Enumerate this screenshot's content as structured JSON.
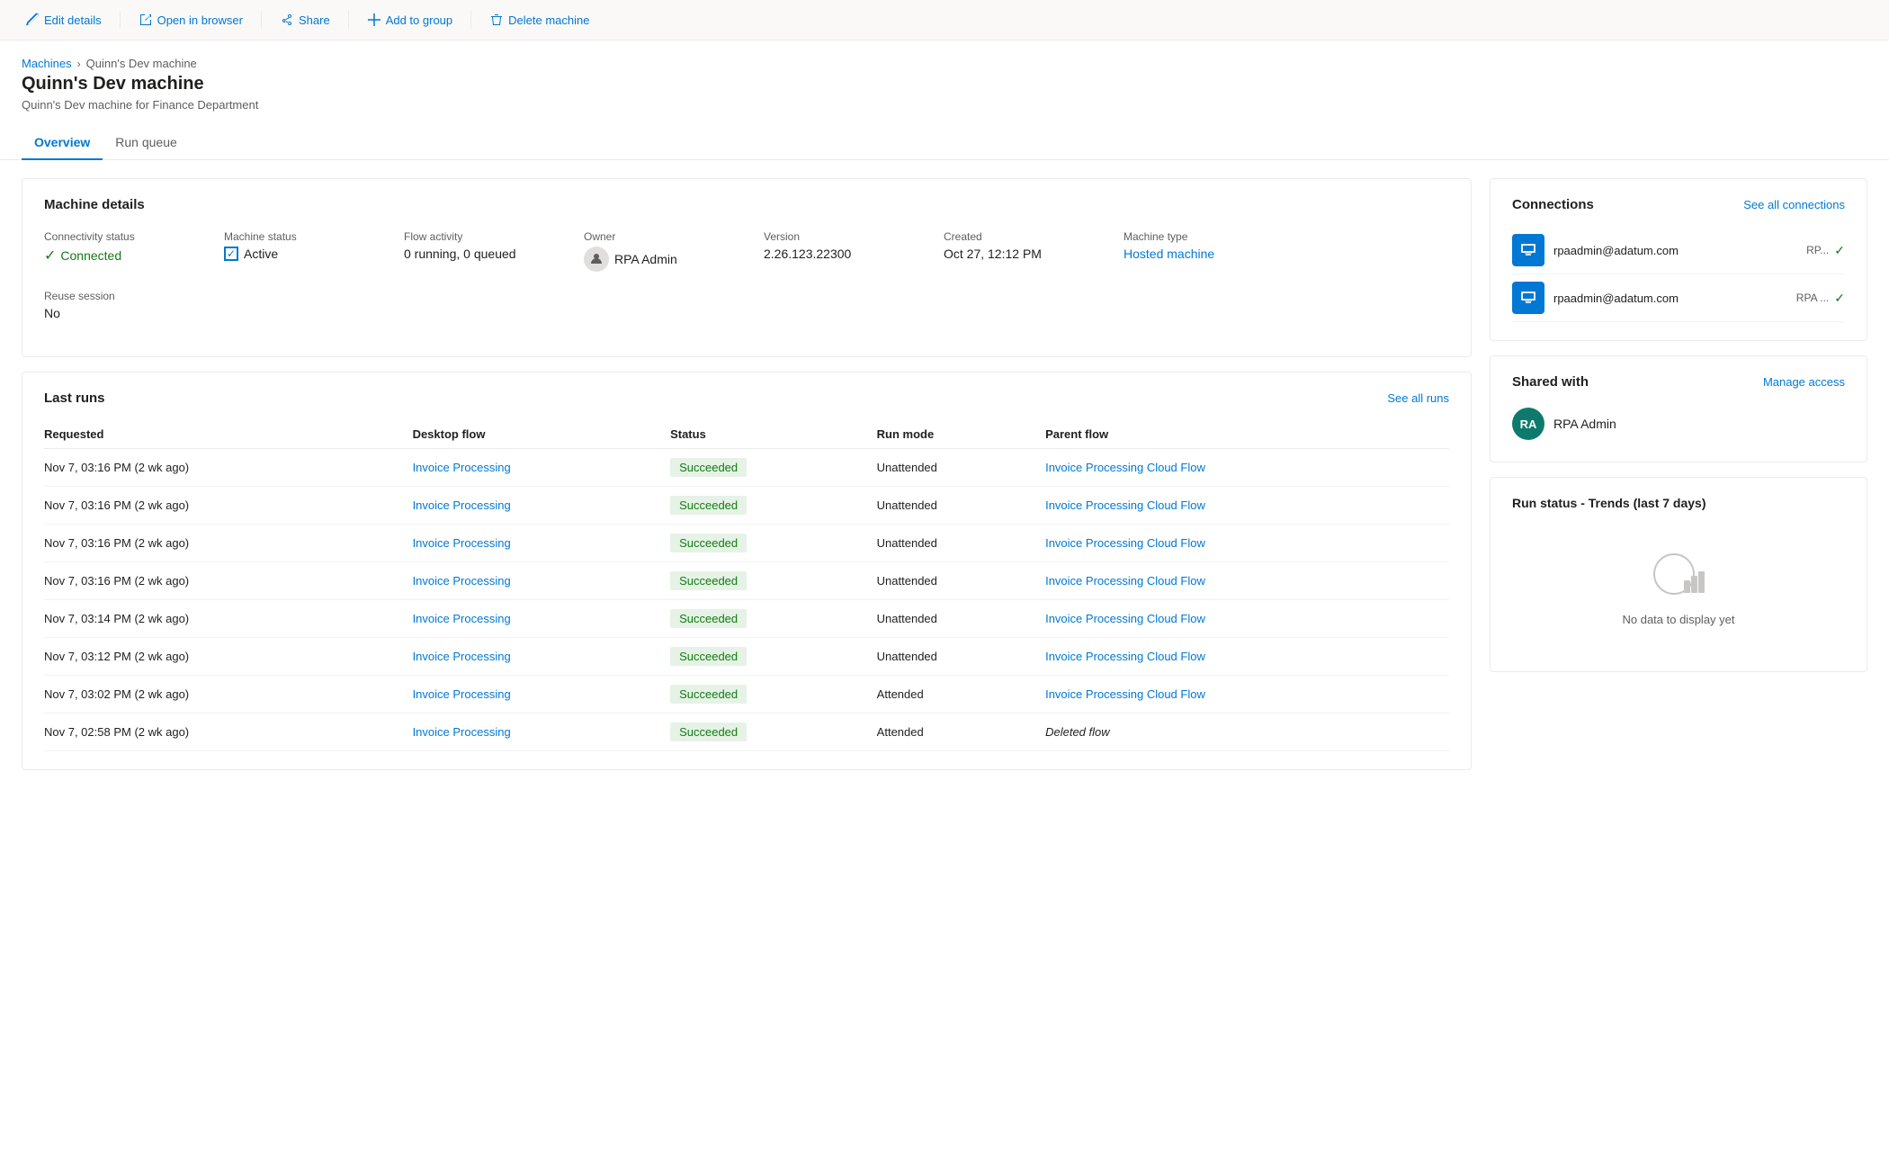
{
  "toolbar": {
    "edit_label": "Edit details",
    "open_browser_label": "Open in browser",
    "share_label": "Share",
    "add_group_label": "Add to group",
    "delete_label": "Delete machine"
  },
  "breadcrumb": {
    "parent": "Machines",
    "current": "Quinn's Dev machine"
  },
  "page": {
    "title": "Quinn's Dev machine",
    "subtitle": "Quinn's Dev machine for Finance Department"
  },
  "tabs": [
    {
      "label": "Overview",
      "active": true
    },
    {
      "label": "Run queue",
      "active": false
    }
  ],
  "machine_details": {
    "card_title": "Machine details",
    "connectivity_label": "Connectivity status",
    "connectivity_value": "Connected",
    "machine_status_label": "Machine status",
    "machine_status_value": "Active",
    "flow_activity_label": "Flow activity",
    "flow_activity_value": "0 running, 0 queued",
    "owner_label": "Owner",
    "owner_value": "RPA Admin",
    "version_label": "Version",
    "version_value": "2.26.123.22300",
    "created_label": "Created",
    "created_value": "Oct 27, 12:12 PM",
    "machine_type_label": "Machine type",
    "machine_type_value": "Hosted machine",
    "reuse_session_label": "Reuse session",
    "reuse_session_value": "No"
  },
  "last_runs": {
    "title": "Last runs",
    "see_all": "See all runs",
    "columns": [
      "Requested",
      "Desktop flow",
      "Status",
      "Run mode",
      "Parent flow"
    ],
    "rows": [
      {
        "requested": "Nov 7, 03:16 PM (2 wk ago)",
        "desktop_flow": "Invoice Processing",
        "status": "Succeeded",
        "run_mode": "Unattended",
        "parent_flow": "Invoice Processing Cloud Flow"
      },
      {
        "requested": "Nov 7, 03:16 PM (2 wk ago)",
        "desktop_flow": "Invoice Processing",
        "status": "Succeeded",
        "run_mode": "Unattended",
        "parent_flow": "Invoice Processing Cloud Flow"
      },
      {
        "requested": "Nov 7, 03:16 PM (2 wk ago)",
        "desktop_flow": "Invoice Processing",
        "status": "Succeeded",
        "run_mode": "Unattended",
        "parent_flow": "Invoice Processing Cloud Flow"
      },
      {
        "requested": "Nov 7, 03:16 PM (2 wk ago)",
        "desktop_flow": "Invoice Processing",
        "status": "Succeeded",
        "run_mode": "Unattended",
        "parent_flow": "Invoice Processing Cloud Flow"
      },
      {
        "requested": "Nov 7, 03:14 PM (2 wk ago)",
        "desktop_flow": "Invoice Processing",
        "status": "Succeeded",
        "run_mode": "Unattended",
        "parent_flow": "Invoice Processing Cloud Flow"
      },
      {
        "requested": "Nov 7, 03:12 PM (2 wk ago)",
        "desktop_flow": "Invoice Processing",
        "status": "Succeeded",
        "run_mode": "Unattended",
        "parent_flow": "Invoice Processing Cloud Flow"
      },
      {
        "requested": "Nov 7, 03:02 PM (2 wk ago)",
        "desktop_flow": "Invoice Processing",
        "status": "Succeeded",
        "run_mode": "Attended",
        "parent_flow": "Invoice Processing Cloud Flow"
      },
      {
        "requested": "Nov 7, 02:58 PM (2 wk ago)",
        "desktop_flow": "Invoice Processing",
        "status": "Succeeded",
        "run_mode": "Attended",
        "parent_flow": "Deleted flow"
      }
    ]
  },
  "connections": {
    "title": "Connections",
    "see_all": "See all connections",
    "items": [
      {
        "email": "rpaadmin@adatum.com",
        "short": "RP..."
      },
      {
        "email": "rpaadmin@adatum.com",
        "short": "RPA ..."
      }
    ]
  },
  "shared_with": {
    "title": "Shared with",
    "manage_access": "Manage access",
    "users": [
      {
        "initials": "RA",
        "name": "RPA Admin",
        "color": "#0e7a6e"
      }
    ]
  },
  "trends": {
    "title": "Run status - Trends (last 7 days)",
    "no_data": "No data to display yet"
  }
}
